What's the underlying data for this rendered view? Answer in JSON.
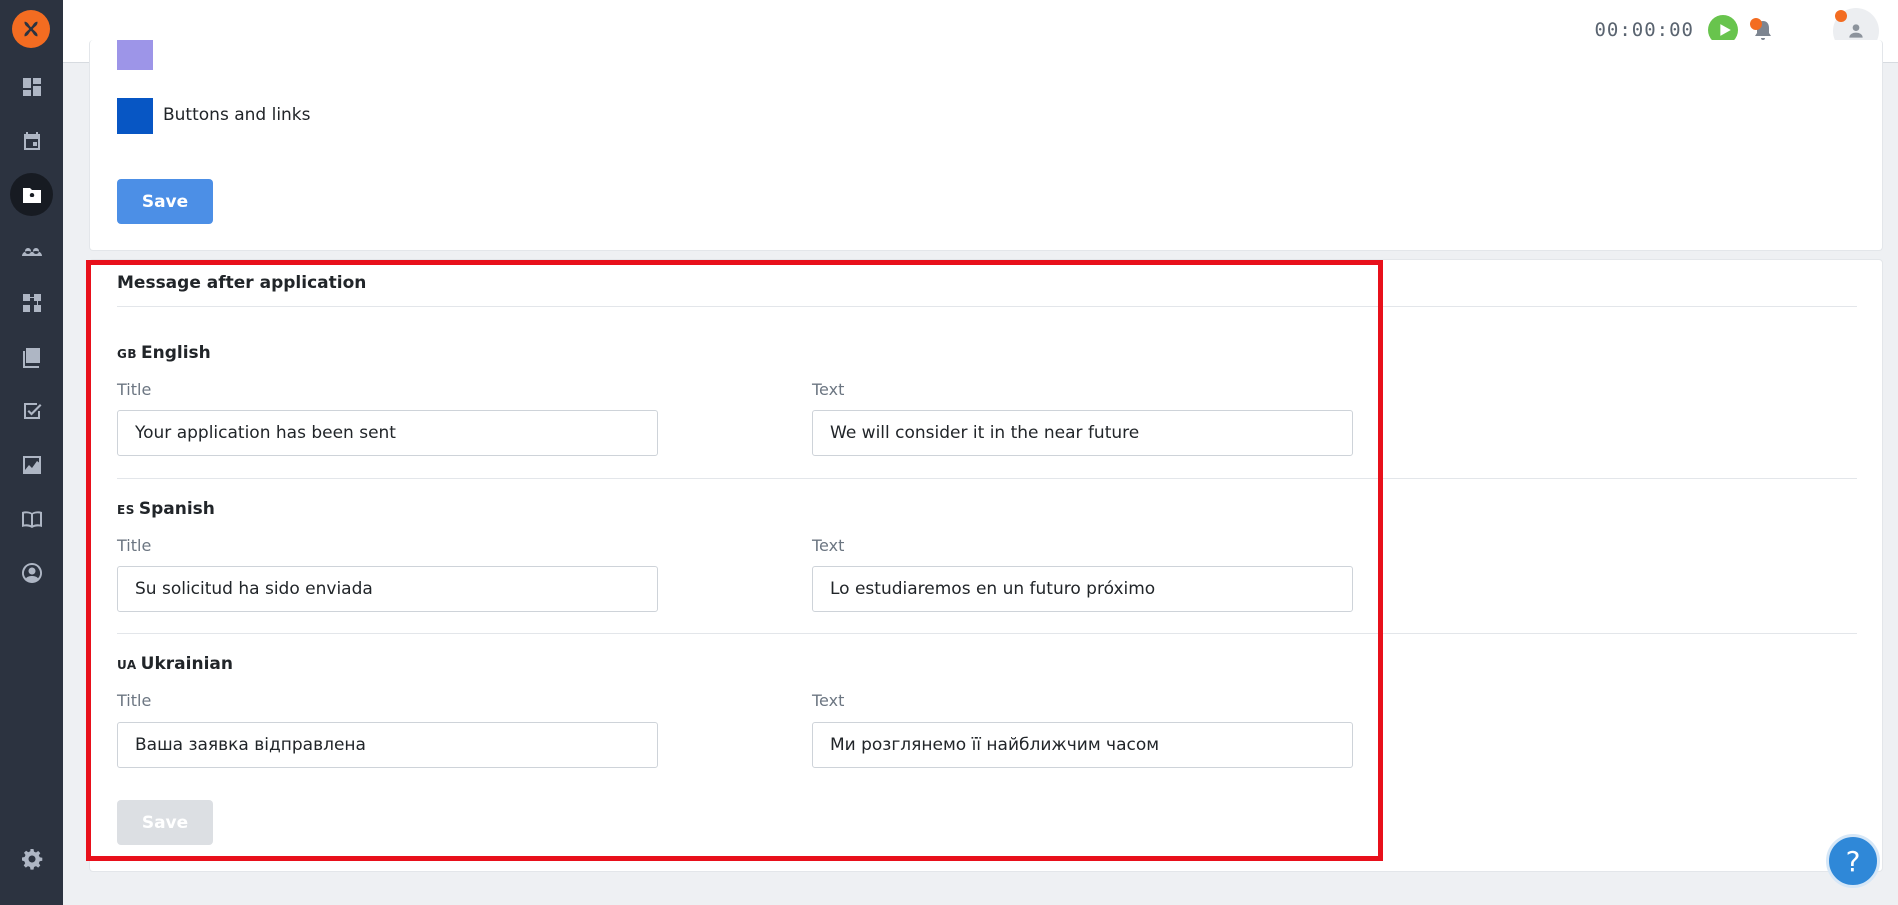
{
  "header": {
    "timer": "00:00:00"
  },
  "sidebar": {
    "items": [
      {
        "name": "dashboard"
      },
      {
        "name": "calendar"
      },
      {
        "name": "applicants"
      },
      {
        "name": "employees"
      },
      {
        "name": "structure"
      },
      {
        "name": "documents"
      },
      {
        "name": "tasks"
      },
      {
        "name": "reports"
      },
      {
        "name": "knowledge-base"
      },
      {
        "name": "profile"
      },
      {
        "name": "settings"
      }
    ]
  },
  "colors_section": {
    "items": [
      {
        "label": "Buttons and links",
        "color": "#0756c4"
      }
    ],
    "partial_swatch_color": "#9d95e8",
    "save_label": "Save"
  },
  "message_section": {
    "title": "Message after application",
    "languages": [
      {
        "code": "GB",
        "name": "English",
        "title_label": "Title",
        "title_value": "Your application has been sent",
        "text_label": "Text",
        "text_value": "We will consider it in the near future"
      },
      {
        "code": "ES",
        "name": "Spanish",
        "title_label": "Title",
        "title_value": "Su solicitud ha sido enviada",
        "text_label": "Text",
        "text_value": "Lo estudiaremos en un futuro próximo"
      },
      {
        "code": "UA",
        "name": "Ukrainian",
        "title_label": "Title",
        "title_value": "Ваша заявка відправлена",
        "text_label": "Text",
        "text_value": "Ми розглянемо її найближчим часом"
      }
    ],
    "save_label": "Save"
  },
  "help": {
    "label": "?"
  },
  "colors": {
    "accent": "#f36c21",
    "primary_button": "#4c8fe6",
    "highlight": "#e8101b",
    "sidebar_bg": "#2c3340"
  }
}
